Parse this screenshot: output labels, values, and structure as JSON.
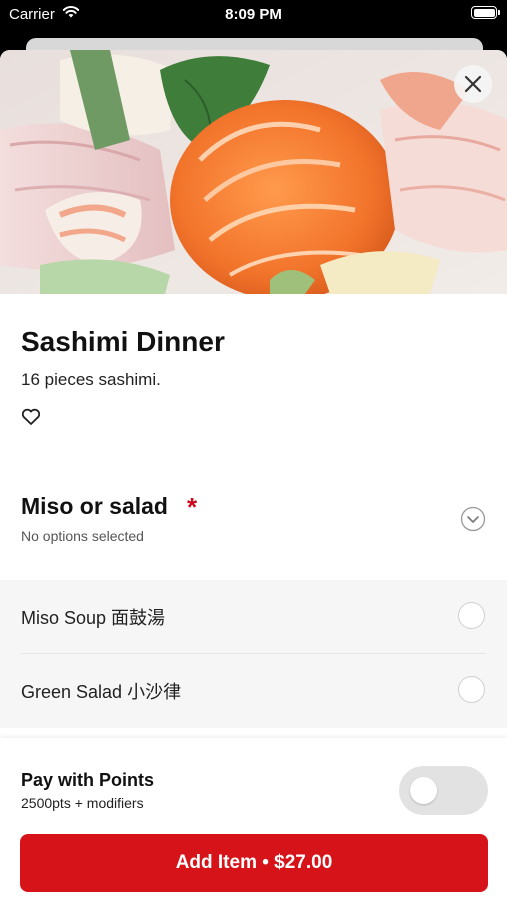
{
  "status_bar": {
    "carrier": "Carrier",
    "time": "8:09 PM"
  },
  "item": {
    "title": "Sashimi Dinner",
    "description": "16 pieces sashimi.",
    "image_alt": "Sashimi platter"
  },
  "modifier_group": {
    "title": "Miso or salad",
    "required_mark": "*",
    "selection_status": "No options selected",
    "options": [
      {
        "label": "Miso Soup 面鼓湯",
        "selected": false
      },
      {
        "label": "Green Salad 小沙律",
        "selected": false
      }
    ]
  },
  "points": {
    "title": "Pay with Points",
    "subtitle": "2500pts + modifiers",
    "enabled": false
  },
  "add_button": {
    "label": "Add Item • $27.00"
  },
  "colors": {
    "accent": "#d7131a",
    "required": "#cc0a1e",
    "toggle_off": "#e2e2e2"
  },
  "icons": [
    "wifi-icon",
    "battery-icon",
    "close-icon",
    "heart-icon",
    "chevron-down-icon"
  ]
}
